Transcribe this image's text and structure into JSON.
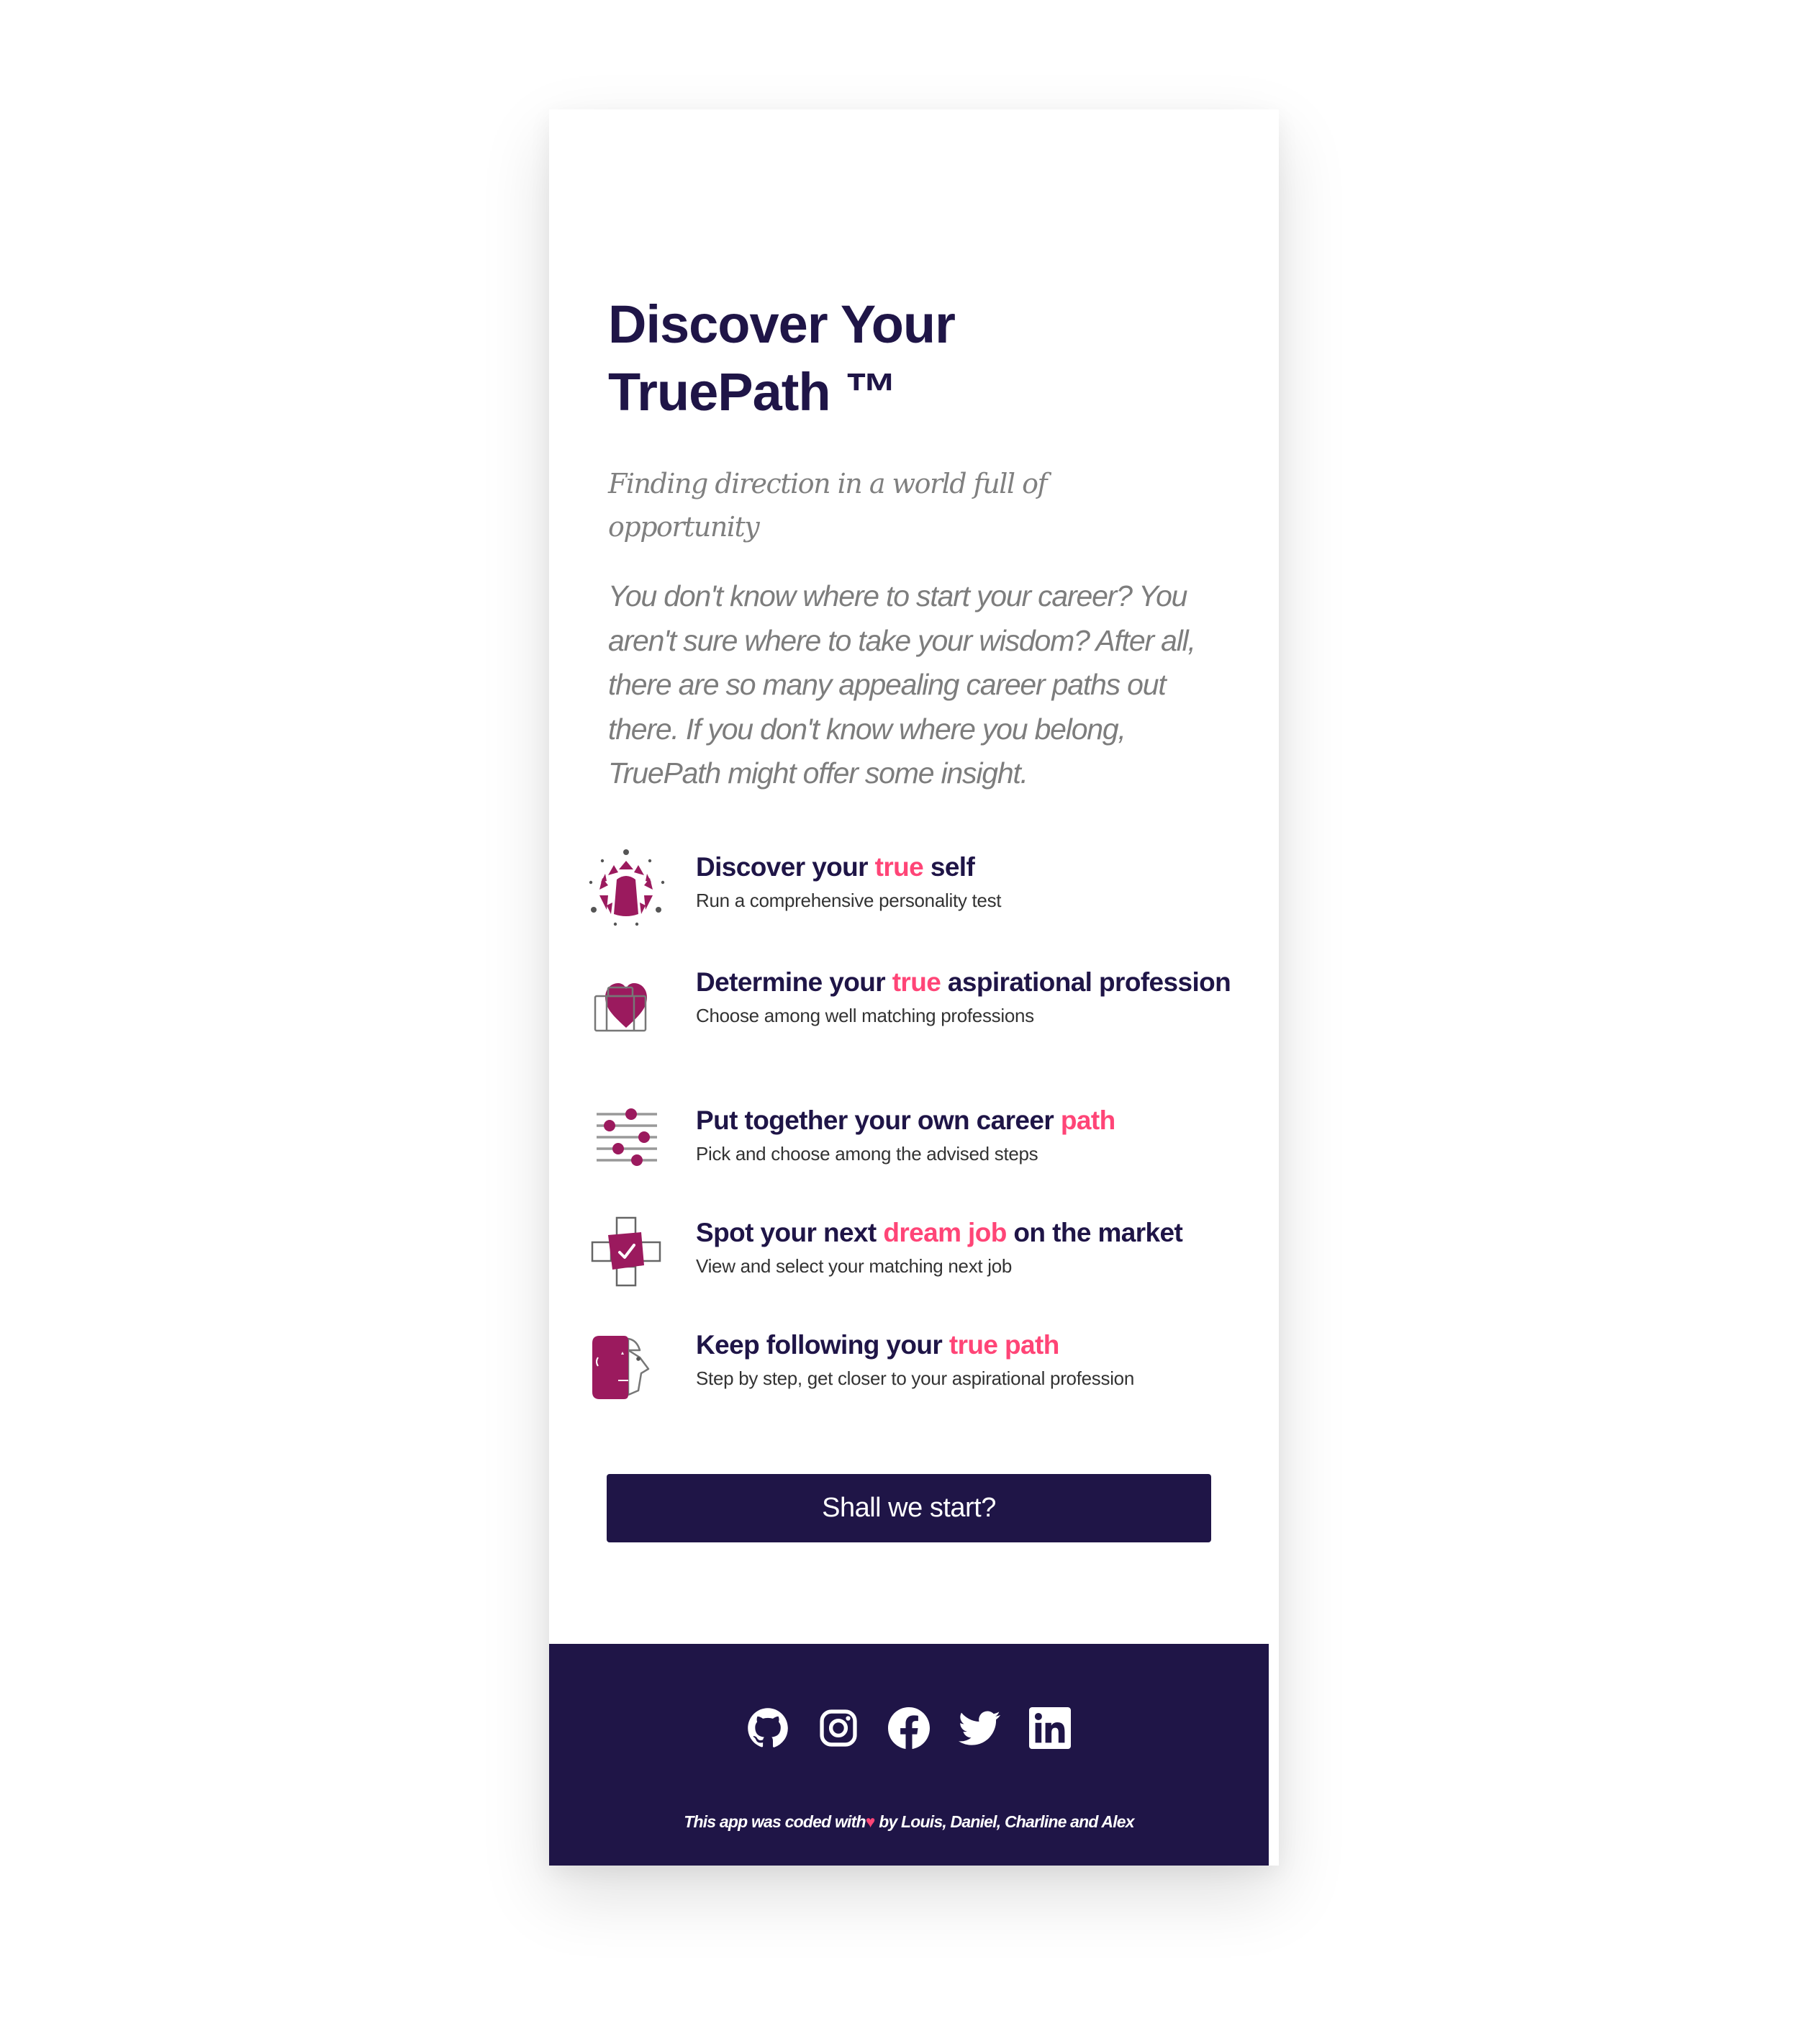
{
  "colors": {
    "primary": "#1f1547",
    "accent": "#ff4577",
    "icon": "#9b1a5e",
    "muted_text": "#808080"
  },
  "hero": {
    "title": "Discover Your TruePath ™",
    "subtitle": "Finding direction in a world full of opportunity",
    "intro": "You don't know where to start your career? You aren't sure where to take your wisdom? After all, there are so many appealing career paths out there. If you don't know where you belong, TruePath might offer some insight."
  },
  "features": [
    {
      "icon": "personality-gem-icon",
      "title_before": "Discover your ",
      "title_highlight": "true",
      "title_after": " self",
      "description": "Run a comprehensive personality test"
    },
    {
      "icon": "heart-briefcase-icon",
      "title_before": "Determine your ",
      "title_highlight": "true",
      "title_after": " aspirational profession",
      "description": "Choose among well matching professions"
    },
    {
      "icon": "sliders-icon",
      "title_before": "Put together your own career ",
      "title_highlight": "path",
      "title_after": "",
      "description": "Pick and choose among the advised steps"
    },
    {
      "icon": "checkbox-cross-icon",
      "title_before": "Spot your next ",
      "title_highlight": "dream job",
      "title_after": " on the market",
      "description": "View and select your matching next job"
    },
    {
      "icon": "two-faces-icon",
      "title_before": "Keep following your ",
      "title_highlight": "true path",
      "title_after": "",
      "description": "Step by step, get closer to your aspirational profession"
    }
  ],
  "cta": {
    "label": "Shall we start?"
  },
  "footer": {
    "socials": [
      {
        "name": "github",
        "icon": "github-icon"
      },
      {
        "name": "instagram",
        "icon": "instagram-icon"
      },
      {
        "name": "facebook",
        "icon": "facebook-icon"
      },
      {
        "name": "twitter",
        "icon": "twitter-icon"
      },
      {
        "name": "linkedin",
        "icon": "linkedin-icon"
      }
    ],
    "credit_before": "This app was coded with",
    "credit_heart": "♥",
    "credit_after": " by Louis, Daniel, Charline and Alex"
  }
}
